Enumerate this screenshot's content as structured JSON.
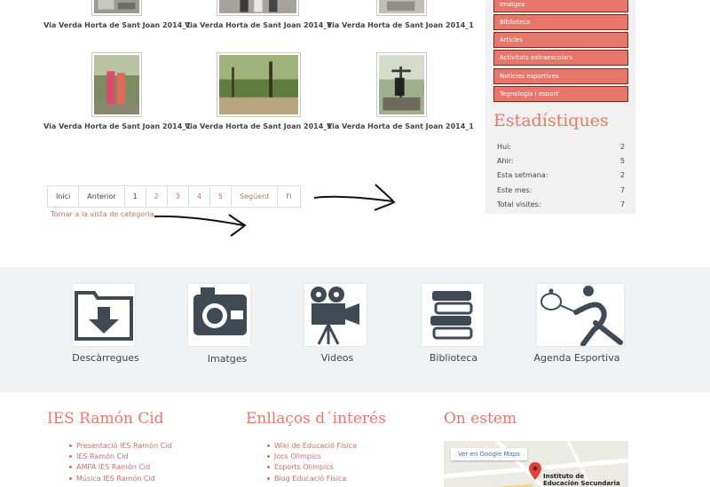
{
  "gallery": {
    "captions": [
      "Via Verda Horta de Sant Joan 2014_1",
      "Via Verda Horta de Sant Joan 2014_1",
      "Via Verda Horta de Sant Joan 2014_1",
      "Via Verda Horta de Sant Joan 2014_1",
      "Via Verda Horta de Sant Joan 2014_1",
      "Via Verda Horta de Sant Joan 2014_1"
    ]
  },
  "pagination": {
    "items": [
      "Inici",
      "Anterior",
      "1",
      "2",
      "3",
      "4",
      "5",
      "Següent",
      "Fi"
    ],
    "back_link": "Tornar a la vista de categoria"
  },
  "sidebar": {
    "menu": [
      "Imatges",
      "Biblioteca",
      "Articles",
      "Activitats extraescolars",
      "Noticies esportives",
      "Tegnologia i esport"
    ],
    "stats_title": "Estadístiques",
    "stats": [
      {
        "label": "Hui:",
        "value": "2"
      },
      {
        "label": "Ahir:",
        "value": "5"
      },
      {
        "label": "Esta setmana:",
        "value": "2"
      },
      {
        "label": "Este mes:",
        "value": "7"
      },
      {
        "label": "Total visites:",
        "value": "7"
      }
    ]
  },
  "features": [
    {
      "label": "Descàrregues",
      "icon": "download-folder-icon"
    },
    {
      "label": "Imatges",
      "icon": "camera-icon"
    },
    {
      "label": "Videos",
      "icon": "film-projector-icon"
    },
    {
      "label": "Biblioteca",
      "icon": "books-icon"
    },
    {
      "label": "Agenda Esportiva",
      "icon": "tennis-player-icon"
    }
  ],
  "footer": {
    "col1": {
      "title": "IES Ramón Cid",
      "links": [
        "Presentació IES Ramón Cid",
        "IES Ramón Cid",
        "AMPA IES Ramón Cid",
        "Música IES Ramón Cid"
      ]
    },
    "col2": {
      "title": "Enllaços d´interés",
      "links": [
        "Wiki de Educació Física",
        "Jocs Olimpics",
        "Esports Olimpics",
        "Blog Educació Física"
      ]
    },
    "col3": {
      "title": "On estem",
      "map_button": "Ver en Google Maps",
      "map_label_line1": "Instituto de",
      "map_label_line2": "Educación Secundaria"
    }
  },
  "colors": {
    "accent": "#e8776b",
    "link": "#c9706a",
    "text": "#444444"
  }
}
